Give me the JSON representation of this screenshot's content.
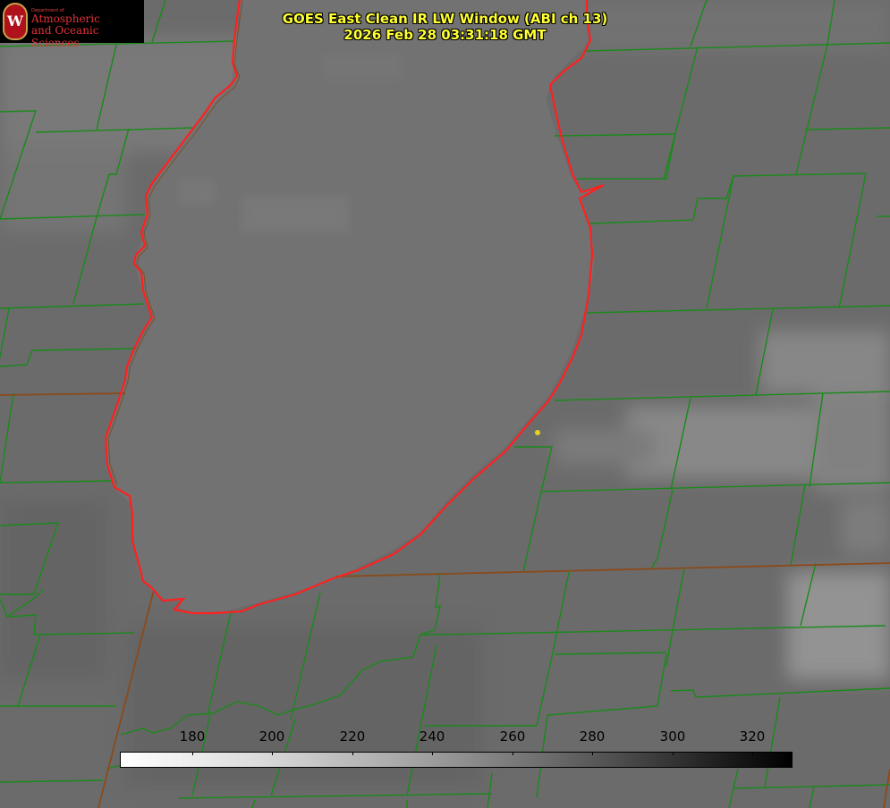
{
  "logo": {
    "dept": "Department of",
    "line1": "Atmospheric",
    "line2": "and Oceanic Sciences",
    "seal_letter": "W"
  },
  "title": {
    "line1": "GOES East Clean IR LW Window (ABI ch 13)",
    "line2": "2026 Feb 28 03:31:18 GMT"
  },
  "colorbar": {
    "ticks": [
      "180",
      "200",
      "220",
      "240",
      "260",
      "280",
      "300",
      "320"
    ]
  },
  "colors": {
    "background_gray": "#6b6b6b",
    "lake_gray": "#717171",
    "county_lines": "#1a8a1a",
    "state_lines": "#8b4a1a",
    "shoreline": "#ff2020",
    "title_text": "#ffff33",
    "marker": "#e6d21a"
  }
}
